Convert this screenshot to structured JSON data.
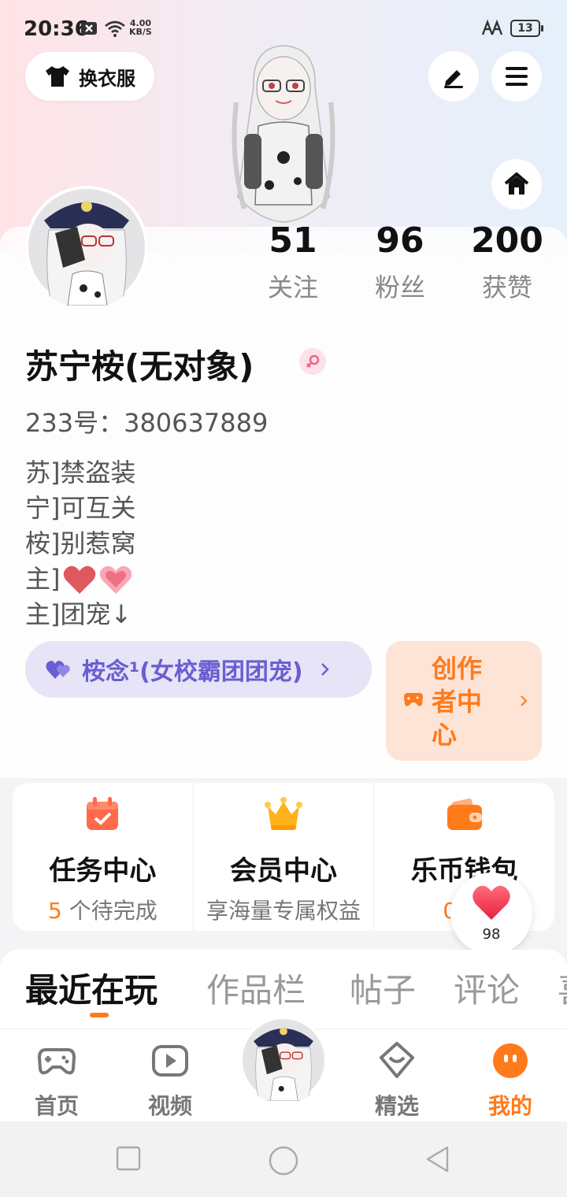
{
  "status_bar": {
    "time": "20:36",
    "net_speed_value": "4.00",
    "net_speed_unit": "KB/S",
    "battery": "13"
  },
  "header": {
    "dress_up_label": "换衣服",
    "icons": [
      "shirt-icon",
      "edit-icon",
      "menu-icon",
      "home-icon"
    ]
  },
  "profile": {
    "stats": [
      {
        "value": "51",
        "label": "关注"
      },
      {
        "value": "96",
        "label": "粉丝"
      },
      {
        "value": "200",
        "label": "获赞"
      }
    ],
    "username": "苏宁桉(无对象)",
    "gender": "female",
    "uid": "233号：380637889",
    "bio": [
      "苏]禁盗装",
      "宁]可互关",
      "桉]别惹窝",
      "主]",
      "主]团宠↓"
    ],
    "club_label": "桉念¹(女校霸团团宠)",
    "creator_center_label": [
      "创作",
      "者中",
      "心"
    ]
  },
  "services": [
    {
      "title": "任务中心",
      "sub_highlight": "5",
      "sub_text": " 个待完成",
      "icon": "calendar-check-icon"
    },
    {
      "title": "会员中心",
      "sub_highlight": "",
      "sub_text": "享海量专属权益",
      "icon": "crown-icon"
    },
    {
      "title": "乐币钱包",
      "sub_highlight": "0",
      "sub_text": " 乐",
      "icon": "wallet-icon"
    }
  ],
  "like_float": {
    "count": "98"
  },
  "tabs": [
    "最近在玩",
    "作品栏",
    "帖子",
    "评论",
    "喜"
  ],
  "active_tab": "最近在玩",
  "bottom_nav": [
    {
      "label": "首页",
      "icon": "gamepad-icon"
    },
    {
      "label": "视频",
      "icon": "video-play-icon"
    },
    {
      "label": "精选",
      "icon": "heart-badge-icon"
    },
    {
      "label": "我的",
      "icon": "profile-face-icon",
      "active": true
    }
  ],
  "colors": {
    "accent": "#ff7a1a",
    "club_text": "#6a5ed3",
    "club_bg": "#e6e4f6",
    "creator_bg": "#fde4d6"
  }
}
